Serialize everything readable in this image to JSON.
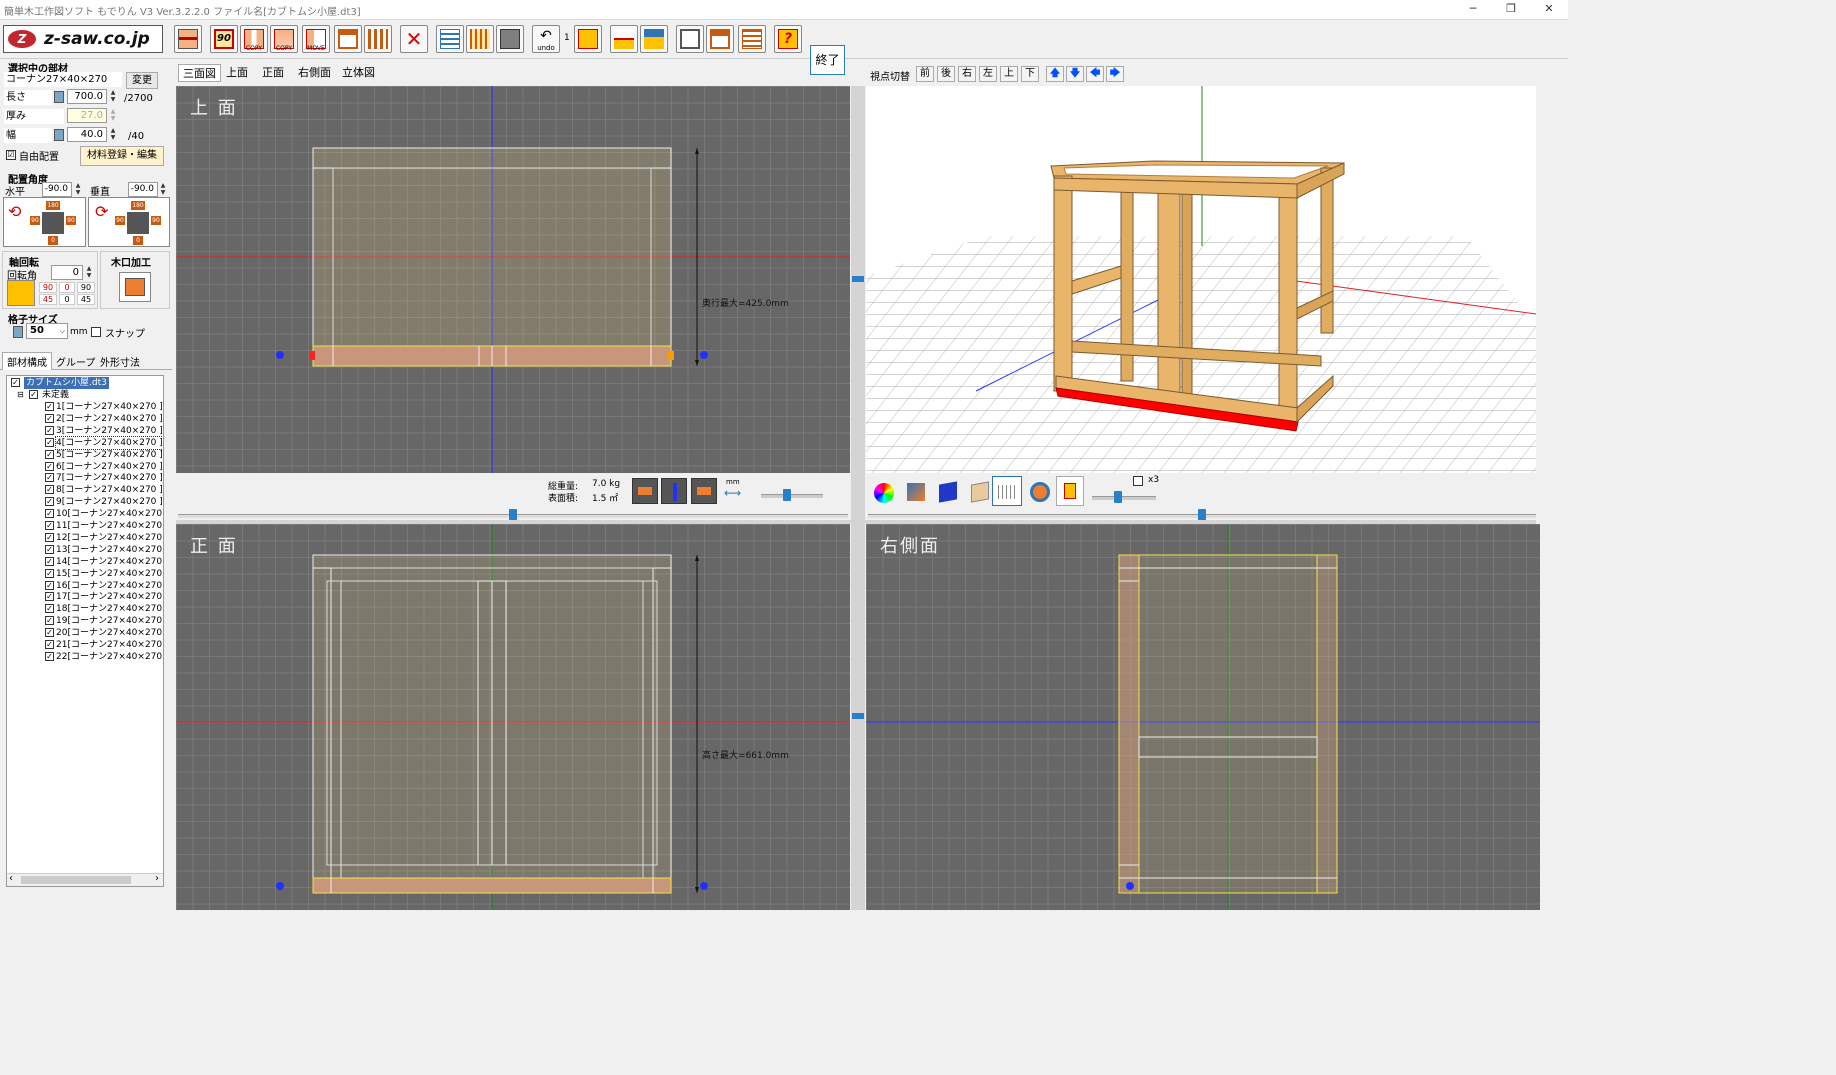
{
  "window": {
    "title": "簡単木工作図ソフト もでりん V3   Ver.3.2.2.0  ファイル名[カブトムシ小屋.dt3]",
    "minimize": "─",
    "restore": "❐",
    "close": "✕"
  },
  "toolbar": {
    "logo": "z-saw.co.jp",
    "logo_mark": "Z",
    "rotate90_label": "90",
    "copy_label": "COPY",
    "rotcopy_label": "COPY",
    "move_label": "MOVE",
    "undo_label": "undo",
    "undo_count": "1",
    "help_label": "HELP",
    "end_label": "終了"
  },
  "left": {
    "selected_heading": "選択中の部材",
    "selected_name": "コーナン27×40×270",
    "change_button": "変更",
    "length_label": "長さ",
    "length_value": "700.0",
    "length_max": "/2700",
    "thickness_label": "厚み",
    "thickness_value": "27.0",
    "width_label": "幅",
    "width_value": "40.0",
    "width_max": "/40",
    "free_place_label": "自由配置",
    "free_place_checked": "☑",
    "material_button": "材料登録・編集",
    "angle_heading": "配置角度",
    "horizontal_label": "水平",
    "horizontal_value": "-90.0",
    "vertical_label": "垂直",
    "vertical_value": "-90.0",
    "ang_180": "180",
    "ang_90": "90",
    "ang_0": "0",
    "axis_heading": "軸回転",
    "rotation_label": "回転角",
    "rotation_value": "0",
    "axis_row1": [
      "90",
      "0",
      "90"
    ],
    "axis_row2": [
      "45",
      "0",
      "45"
    ],
    "kiguchi_label": "木口加工",
    "grid_heading": "格子サイズ",
    "grid_value": "50",
    "grid_unit": "mm",
    "snap_label": "スナップ",
    "tabs": [
      "部材構成",
      "グループ",
      "外形寸法"
    ],
    "tree_root": "カブトムシ小屋.dt3",
    "tree_group": "未定義",
    "tree_items": [
      "1[コーナン27×40×270 ]",
      "2[コーナン27×40×270 ]",
      "3[コーナン27×40×270 ]",
      "4[コーナン27×40×270 ]",
      "5[コーナン27×40×270 ]",
      "6[コーナン27×40×270 ]",
      "7[コーナン27×40×270 ]",
      "8[コーナン27×40×270 ]",
      "9[コーナン27×40×270 ]",
      "10[コーナン27×40×270",
      "11[コーナン27×40×270",
      "12[コーナン27×40×270",
      "13[コーナン27×40×270",
      "14[コーナン27×40×270",
      "15[コーナン27×40×270",
      "16[コーナン27×40×270",
      "17[コーナン27×40×270",
      "18[コーナン27×40×270",
      "19[コーナン27×40×270",
      "20[コーナン27×40×270",
      "21[コーナン27×40×270",
      "22[コーナン27×40×270"
    ],
    "scroll_left": "‹",
    "scroll_right": "›"
  },
  "view_tabs": [
    "三面図",
    "上面",
    "正面",
    "右側面",
    "立体図"
  ],
  "views": {
    "top_label": "上 面",
    "top_dim": "奥行最大=425.0mm",
    "front_label": "正 面",
    "front_dim": "高さ最大=661.0mm",
    "right_label": "右側面"
  },
  "status": {
    "weight_label": "総重量:",
    "weight_value": "7.0 kg",
    "area_label": "表面積:",
    "area_value": "1.5 ㎡",
    "mm_label": "mm"
  },
  "view3d": {
    "switch_label": "視点切替",
    "buttons": [
      "前",
      "後",
      "右",
      "左",
      "上",
      "下"
    ],
    "arrows": [
      "🡅",
      "🡇",
      "🡄",
      "🡆"
    ],
    "x3_label": "x3"
  },
  "colors": {
    "wood": "#e8b56a",
    "selected": "#ff0000",
    "viewport": "#676767",
    "outline_yellow": "#f2e24a"
  }
}
